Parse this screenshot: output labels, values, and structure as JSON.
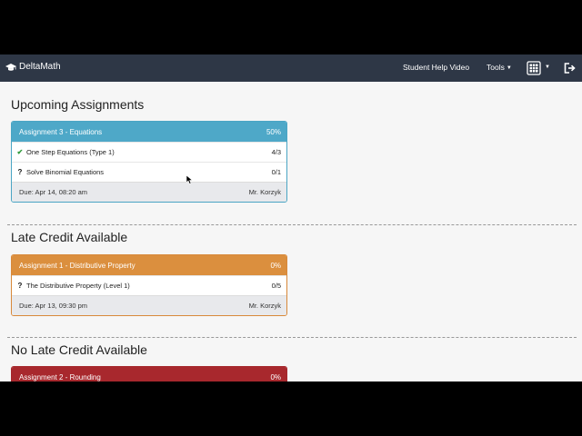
{
  "topbar": {
    "brand": "DeltaMath",
    "help_link": "Student Help Video",
    "tools_label": "Tools",
    "icons": [
      "graduation-cap-icon",
      "calculator-icon",
      "chevron-down-icon",
      "logout-icon"
    ]
  },
  "sections": [
    {
      "title": "Upcoming Assignments",
      "cards": [
        {
          "color": "#4ea8c8",
          "name": "Assignment 3 - Equations",
          "percent": "50%",
          "problems": [
            {
              "status": "✔",
              "name": "One Step Equations (Type 1)",
              "score": "4/3"
            },
            {
              "status": "?",
              "name": "Solve Binomial Equations",
              "score": "0/1"
            }
          ],
          "due": "Due: Apr 14, 08:20 am",
          "teacher": "Mr. Korzyk"
        }
      ]
    },
    {
      "title": "Late Credit Available",
      "cards": [
        {
          "color": "#db8f3e",
          "name": "Assignment 1 - Distributive Property",
          "percent": "0%",
          "problems": [
            {
              "status": "?",
              "name": "The Distributive Property (Level 1)",
              "score": "0/5"
            }
          ],
          "due": "Due: Apr 13, 09:30 pm",
          "teacher": "Mr. Korzyk"
        }
      ]
    },
    {
      "title": "No Late Credit Available",
      "cards": [
        {
          "color": "#a8282d",
          "name": "Assignment 2 - Rounding",
          "percent": "0%"
        }
      ]
    }
  ]
}
